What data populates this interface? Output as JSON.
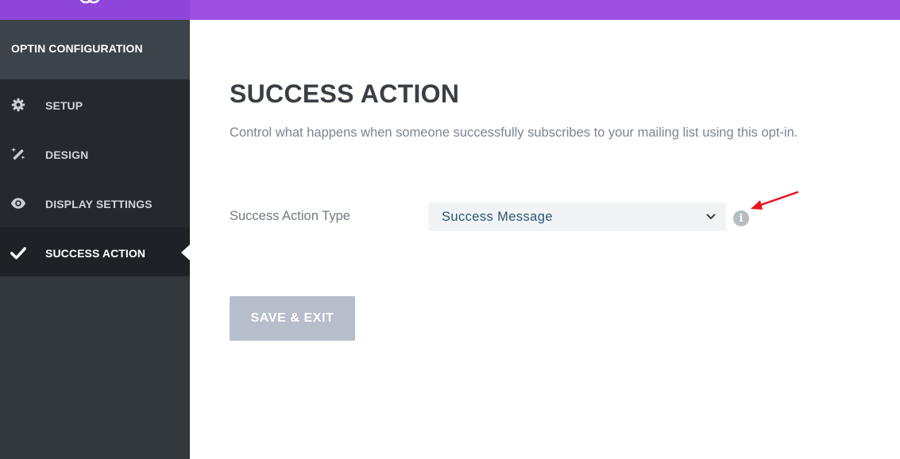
{
  "sidebar": {
    "header": "OPTIN CONFIGURATION",
    "items": [
      {
        "label": "SETUP",
        "icon": "gear-icon"
      },
      {
        "label": "DESIGN",
        "icon": "magic-wand-icon"
      },
      {
        "label": "DISPLAY SETTINGS",
        "icon": "eye-icon"
      },
      {
        "label": "SUCCESS ACTION",
        "icon": "checkmark-icon",
        "active": true
      }
    ]
  },
  "main": {
    "title": "SUCCESS ACTION",
    "description": "Control what happens when someone successfully subscribes to your mailing list using this opt-in.",
    "field": {
      "label": "Success Action Type",
      "value": "Success Message",
      "info_glyph": "i"
    },
    "save_label": "SAVE & EXIT"
  },
  "colors": {
    "topbar": "#9e4fe1",
    "sidebar": "#32373c",
    "sidebar_active": "#1e2226",
    "button": "#b6bdcb",
    "annotation_arrow": "#e8141b"
  }
}
